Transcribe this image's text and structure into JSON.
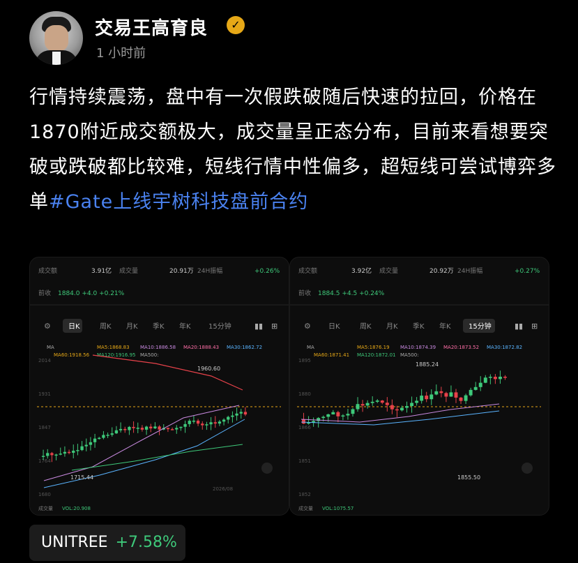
{
  "author": {
    "name": "交易王高育良",
    "verified_icon": "verified-badge-icon",
    "time": "1 小时前"
  },
  "post": {
    "text": "行情持续震荡，盘中有一次假跌破随后快速的拉回，价格在1870附近成交额极大，成交量呈正态分布，目前来看想要突破或跌破都比较难，短线行情中性偏多，超短线可尝试博弈多单",
    "hashtag": "#Gate上线宇树科技盘前合约"
  },
  "charts": [
    {
      "stats": {
        "turnover_label": "成交额",
        "turnover": "3.91亿",
        "volume_label": "成交量",
        "volume": "20.91万",
        "amp_label": "24H振幅",
        "change": "+0.26%"
      },
      "ref_row": {
        "label": "前收",
        "price": "1884.0",
        "delta": "+4.0",
        "pct": "+0.21%"
      },
      "tabs": [
        "日K",
        "周K",
        "月K",
        "季K",
        "年K",
        "15分钟"
      ],
      "active_tab": 0,
      "ma_legend": [
        "MA",
        "MA5:1868.83",
        "MA10:1886.58",
        "MA20:1888.43",
        "MA30:1862.72",
        "MA60:1918.56",
        "MA120:1916.95",
        "MA500:"
      ],
      "price_ticks": [
        "2014",
        "1931",
        "1847",
        "1764",
        "1680"
      ],
      "high_label": "1960.60",
      "low_label": "1715.44",
      "date_label": "2026/08",
      "vol_label": "成交量",
      "vol_value": "VOL:20.908"
    },
    {
      "stats": {
        "turnover_label": "成交额",
        "turnover": "3.92亿",
        "volume_label": "成交量",
        "volume": "20.92万",
        "amp_label": "24H振幅",
        "change": "+0.27%"
      },
      "ref_row": {
        "label": "前收",
        "price": "1884.5",
        "delta": "+4.5",
        "pct": "+0.24%"
      },
      "tabs": [
        "日K",
        "周K",
        "月K",
        "季K",
        "年K",
        "15分钟"
      ],
      "active_tab": 5,
      "ma_legend": [
        "MA",
        "MA5:1876.19",
        "MA10:1874.39",
        "MA20:1873.52",
        "MA30:1872.82",
        "MA60:1871.41",
        "MA120:1872.01",
        "MA500:"
      ],
      "price_ticks": [
        "1895",
        "1880",
        "1866",
        "1851",
        "1852"
      ],
      "high_label": "1885.24",
      "low_label": "1855.50",
      "vol_label": "成交量",
      "vol_value": "VOL:1075.57"
    }
  ],
  "ticker": {
    "symbol": "UNITREE",
    "change": "+7.58%"
  },
  "colors": {
    "up": "#3ec97a",
    "down": "#e8424a",
    "link": "#4a82f0",
    "badge": "#e6a817",
    "background": "#000000"
  }
}
